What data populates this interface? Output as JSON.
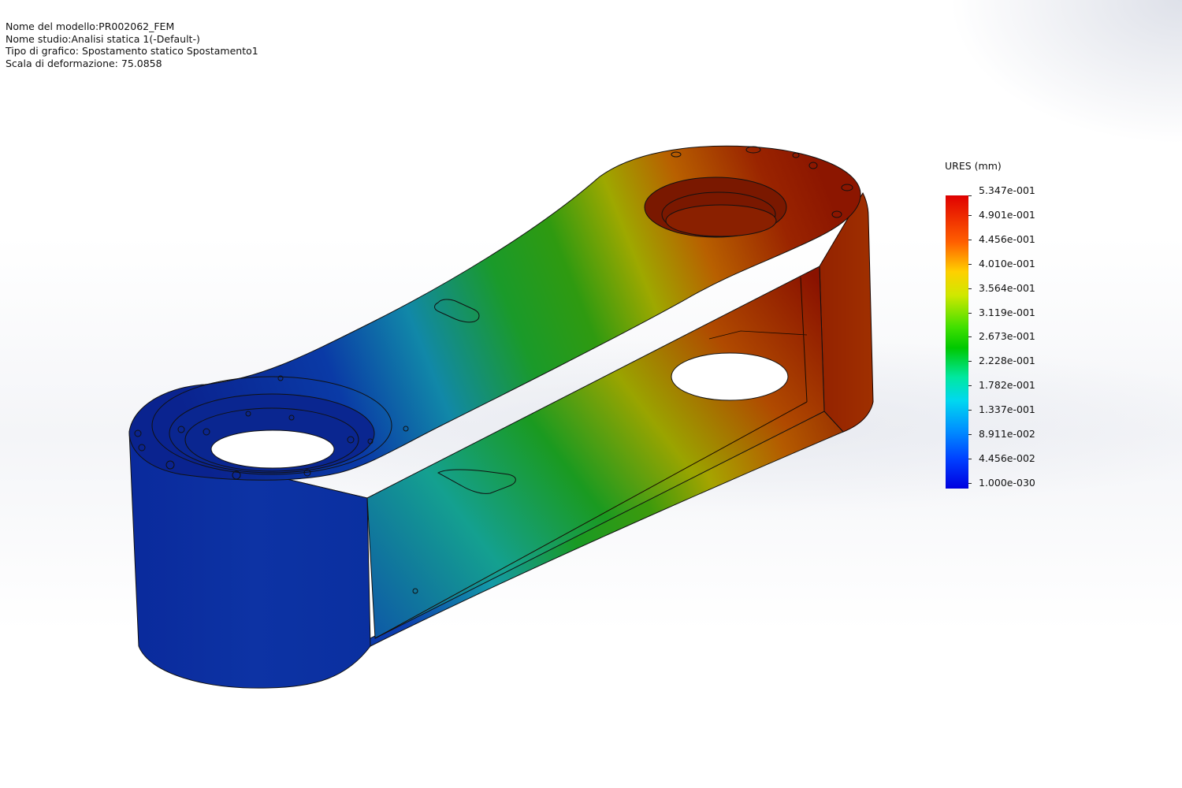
{
  "header": {
    "model_name": "Nome del modello:PR002062_FEM",
    "study_name": "Nome studio:Analisi statica 1(-Default-)",
    "plot_type": "Tipo di grafico: Spostamento statico Spostamento1",
    "deformation_scale": "Scala di deformazione: 75.0858"
  },
  "legend": {
    "title": "URES (mm)",
    "values": [
      "5.347e-001",
      "4.901e-001",
      "4.456e-001",
      "4.010e-001",
      "3.564e-001",
      "3.119e-001",
      "2.673e-001",
      "2.228e-001",
      "1.782e-001",
      "1.337e-001",
      "8.911e-002",
      "4.456e-002",
      "1.000e-030"
    ],
    "max_color": "#e00000",
    "min_color": "#0000e0"
  },
  "model": {
    "description_icon": "fem-displacement-part",
    "colors": {
      "blue": "#0b2fa8",
      "cyan": "#11a3a8",
      "green": "#1a9a1a",
      "yellow": "#b8b000",
      "orange": "#b25a00",
      "red": "#8e1a00"
    }
  }
}
